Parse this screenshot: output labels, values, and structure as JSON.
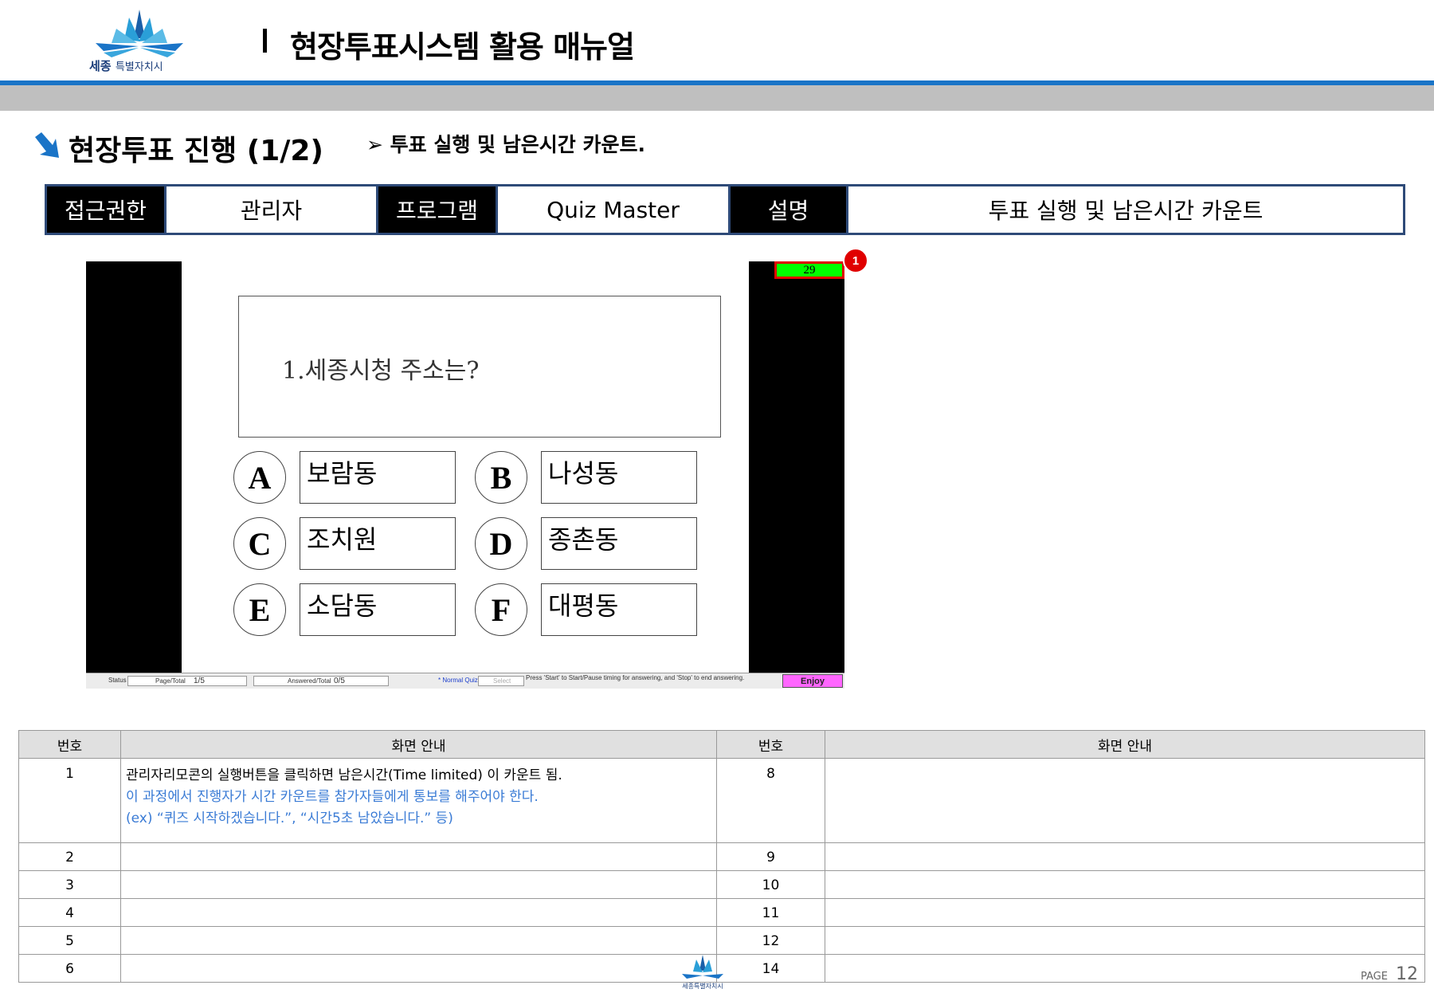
{
  "header": {
    "logo_main": "세종",
    "logo_sub": "특별자치시",
    "title": "현장투표시스템 활용 매뉴얼"
  },
  "section": {
    "title": "현장투표 진행 (1/2)",
    "subtitle": "➢ 투표 실행 및 남은시간 카운트."
  },
  "info_bar": {
    "access_label": "접근권한",
    "access_value": "관리자",
    "program_label": "프로그램",
    "program_value": "Quiz Master",
    "desc_label": "설명",
    "desc_value": "투표 실행 및 남은시간 카운트"
  },
  "quiz": {
    "timer": "29",
    "callout": "1",
    "question": "1.세종시청 주소는?",
    "options": [
      {
        "letter": "A",
        "text": "보람동"
      },
      {
        "letter": "B",
        "text": "나성동"
      },
      {
        "letter": "C",
        "text": "조치원"
      },
      {
        "letter": "D",
        "text": "종촌동"
      },
      {
        "letter": "E",
        "text": "소담동"
      },
      {
        "letter": "F",
        "text": "대평동"
      }
    ],
    "status": {
      "status_label": "Status",
      "page_label": "Page/Total",
      "page_value": "1/5",
      "answered_label": "Answered/Total",
      "answered_value": "0/5",
      "mode": "* Normal Quiz",
      "select_label": "Select",
      "hint": "Press 'Start' to Start/Pause timing for answering, and 'Stop' to end answering.",
      "enjoy": "Enjoy"
    }
  },
  "table": {
    "headers": [
      "번호",
      "화면 안내",
      "번호",
      "화면 안내"
    ],
    "row1": {
      "num_left": "1",
      "line1": "관리자리모콘의 실행버튼을 클릭하면 남은시간(Time limited) 이 카운트 됨.",
      "line2": "이 과정에서 진행자가 시간 카운트를 참가자들에게 통보를 해주어야 한다.",
      "line3": "(ex) “퀴즈 시작하겠습니다.”, “시간5초 남았습니다.” 등)",
      "num_right": "8"
    },
    "rows": [
      {
        "left": "2",
        "right": "9"
      },
      {
        "left": "3",
        "right": "10"
      },
      {
        "left": "4",
        "right": "11"
      },
      {
        "left": "5",
        "right": "12"
      },
      {
        "left": "6",
        "right": "14"
      }
    ]
  },
  "footer": {
    "page_label": "PAGE",
    "page_number": "12"
  },
  "colors": {
    "accent_blue": "#1a74c7",
    "band_gray": "#bfbfbf",
    "timer_green": "#00ff00",
    "callout_red": "#e00000",
    "note_blue": "#3a7bd5"
  }
}
